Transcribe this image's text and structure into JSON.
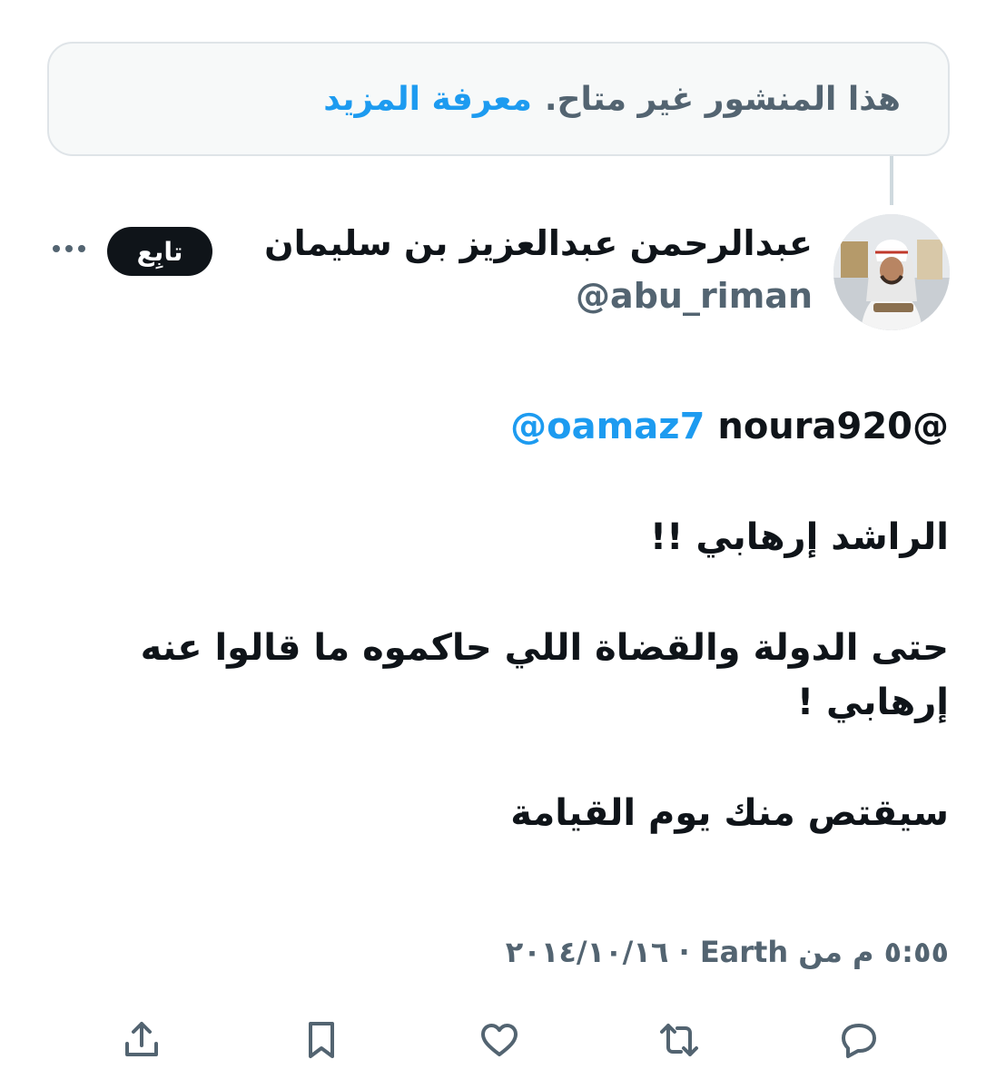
{
  "notice": {
    "text": "هذا المنشور غير متاح.",
    "link": "معرفة المزيد"
  },
  "author": {
    "display_name": "عبدالرحمن عبدالعزيز بن سليمان",
    "handle": "@abu_riman",
    "follow_label": "تابِع"
  },
  "tweet": {
    "mention_1": "noura920@",
    "mention_2": "@oamaz7",
    "line_1": "الراشد إرهابي !!",
    "line_2": "حتى الدولة والقضاة اللي حاكموه ما قالوا عنه إرهابي !",
    "line_3": "سيقتص منك يوم القيامة"
  },
  "meta": {
    "text": "٥:٥٥ م من Earth · ٢٠١٤/١٠/١٦"
  },
  "actions": {
    "icons": [
      "reply-icon",
      "retweet-icon",
      "like-icon",
      "bookmark-icon",
      "share-icon"
    ]
  },
  "colors": {
    "link": "#1d9bf0",
    "muted": "#536471",
    "text": "#0f1419"
  }
}
